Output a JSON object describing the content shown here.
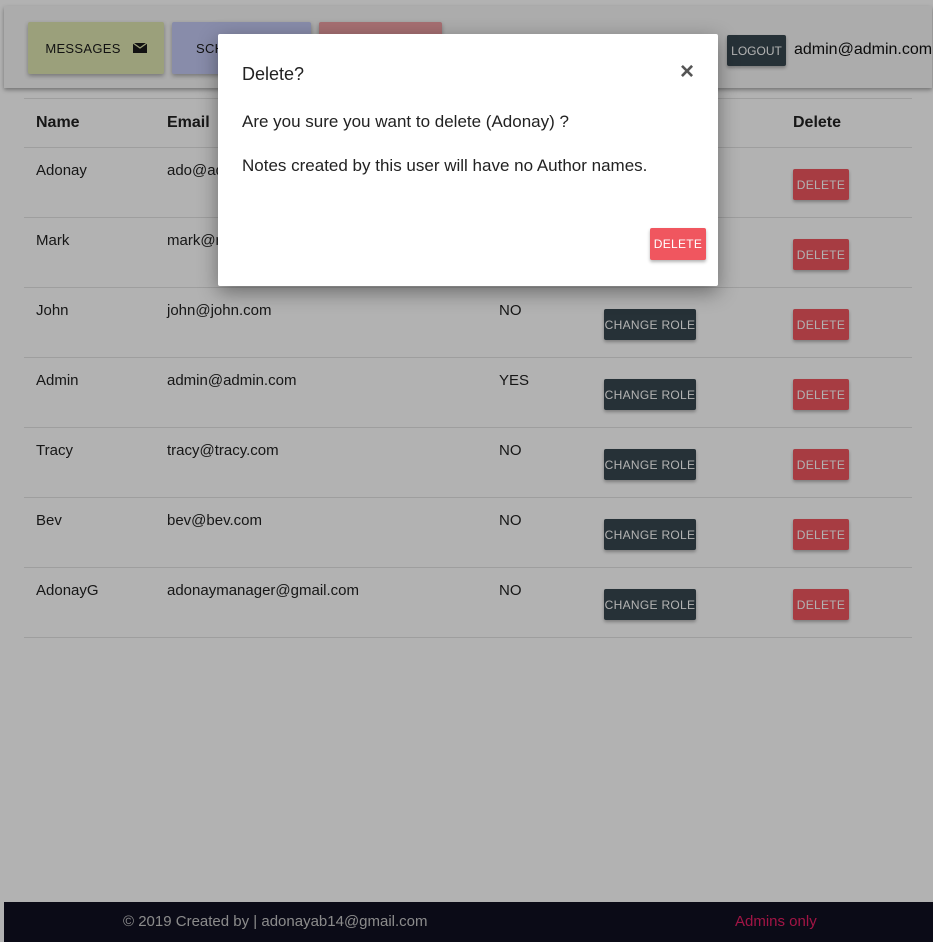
{
  "nav": {
    "messages_label": "MESSAGES",
    "messages_icon": "envelope-icon",
    "schedule_label": "SCH",
    "third_label": "",
    "logout_label": "LOGOUT",
    "user_email": "admin@admin.com"
  },
  "table": {
    "headers": {
      "name": "Name",
      "email": "Email",
      "delete": "Delete"
    },
    "change_role_label": "CHANGE ROLE",
    "delete_label": "DELETE",
    "rows": [
      {
        "name": "Adonay",
        "email": "ado@ad",
        "admin": ""
      },
      {
        "name": "Mark",
        "email": "mark@m",
        "admin": ""
      },
      {
        "name": "John",
        "email": "john@john.com",
        "admin": "NO"
      },
      {
        "name": "Admin",
        "email": "admin@admin.com",
        "admin": "YES"
      },
      {
        "name": "Tracy",
        "email": "tracy@tracy.com",
        "admin": "NO"
      },
      {
        "name": "Bev",
        "email": "bev@bev.com",
        "admin": "NO"
      },
      {
        "name": "AdonayG",
        "email": "adonaymanager@gmail.com",
        "admin": "NO"
      }
    ]
  },
  "footer": {
    "copyright": "© 2019 Created by | adonayab14@gmail.com",
    "admins_only": "Admins only"
  },
  "modal": {
    "title": "Delete?",
    "close": "×",
    "message": "Are you sure you want to delete (Adonay) ?",
    "note": "Notes created by this user will have no Author names.",
    "delete_label": "DELETE"
  },
  "colors": {
    "dark_button": "#37474f",
    "delete_button": "#f0565f",
    "footer_bg": "#111122",
    "admins_only": "#e91e63"
  }
}
